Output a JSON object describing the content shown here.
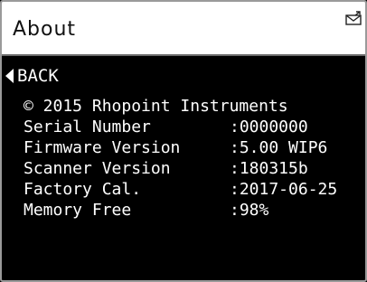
{
  "header": {
    "title": "About",
    "icon": "email-icon"
  },
  "back": {
    "label": "BACK",
    "icon": "back-arrow-icon"
  },
  "about": {
    "copyright": "© 2015 Rhopoint Instruments",
    "rows": [
      {
        "label": "Serial Number",
        "value": ":0000000"
      },
      {
        "label": "Firmware Version",
        "value": ":5.00 WIP6"
      },
      {
        "label": "Scanner Version",
        "value": ":180315b"
      },
      {
        "label": "Factory Cal.",
        "value": ":2017-06-25"
      },
      {
        "label": "Memory Free",
        "value": ":98%"
      }
    ]
  },
  "colors": {
    "background": "#000000",
    "header_background": "#ffffff",
    "text": "#ffffff",
    "header_text": "#111111"
  }
}
